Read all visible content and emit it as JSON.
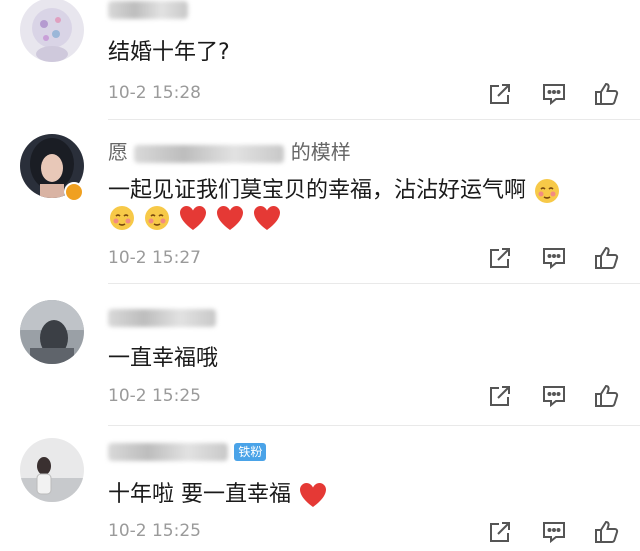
{
  "comments": [
    {
      "name_suffix": "",
      "text": "结婚十年了?",
      "time": "10-2 15:28"
    },
    {
      "name_prefix": "愿",
      "name_suffix": "的模样",
      "text": "一起见证我们莫宝贝的幸福，沾沾好运气啊",
      "time": "10-2 15:27"
    },
    {
      "text": "一直幸福哦",
      "time": "10-2 15:25"
    },
    {
      "fan_badge": "铁粉",
      "text": "十年啦 要一直幸福",
      "time": "10-2 15:25"
    }
  ],
  "icons": {
    "share": "share-icon",
    "comment": "comment-icon",
    "like": "thumbs-up-icon",
    "emoji": "blush-emoji-icon",
    "heart": "red-heart-icon"
  },
  "colors": {
    "heart": "#e53935",
    "time": "#9a9a9a",
    "fan_badge": "#4aa3e8"
  }
}
